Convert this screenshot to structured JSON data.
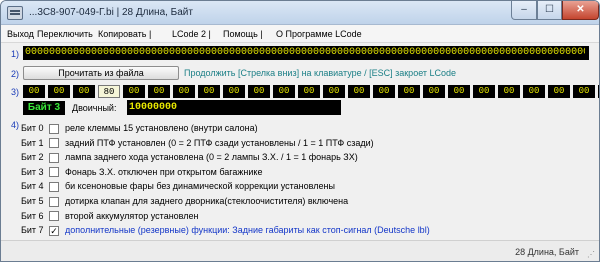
{
  "window": {
    "title": "...3C8-907-049-Г.bi | 28 Длина, Байт",
    "minimize": "–",
    "maximize": "☐",
    "close": "✕"
  },
  "menu": [
    "Выход",
    "Переключить",
    "Копировать |",
    "LCode 2 |",
    "Помощь |",
    "О Программе LCode"
  ],
  "row_numbers": [
    "1)",
    "2)",
    "3)",
    "4)"
  ],
  "coding_string": "00000000000000000000000000000000000000000000000000000000000000000000000000000000000000000000000000000000000",
  "read_button": "Прочитать из файла",
  "hint": "Продолжить [Стрелка вниз] на клавиатуре / [ESC] закроет LCode",
  "hex_bytes": [
    "00",
    "00",
    "00",
    "80",
    "00",
    "00",
    "00",
    "00",
    "00",
    "00",
    "00",
    "00",
    "00",
    "00",
    "00",
    "00",
    "00",
    "00",
    "00",
    "00",
    "00",
    "00",
    "00",
    "00",
    "00",
    "00",
    "00",
    "00"
  ],
  "selected_byte_index": 3,
  "byte_label": "Байт 3",
  "binary_label": "Двоичный:",
  "binary_value": "10000000",
  "bits": [
    {
      "label": "Бит 0",
      "checked": false,
      "text": "реле клеммы 15 установлено (внутри салона)",
      "highlight": false
    },
    {
      "label": "Бит 1",
      "checked": false,
      "text": "задний ПТФ установлен (0 = 2 ПТФ сзади установлены / 1 = 1 ПТФ сзади)",
      "highlight": false
    },
    {
      "label": "Бит 2",
      "checked": false,
      "text": "лампа заднего хода установлена (0 = 2 лампы З.Х. / 1 = 1 фонарь ЗХ)",
      "highlight": false
    },
    {
      "label": "Бит 3",
      "checked": false,
      "text": "Фонарь З.Х. отключен при открытом багажнике",
      "highlight": false
    },
    {
      "label": "Бит 4",
      "checked": false,
      "text": "би ксеноновые фары без динамической коррекции установлены",
      "highlight": false
    },
    {
      "label": "Бит 5",
      "checked": false,
      "text": "дотирка клапан для заднего дворника(стеклоочистителя) включена",
      "highlight": false
    },
    {
      "label": "Бит 6",
      "checked": false,
      "text": "второй аккумулятор установлен",
      "highlight": false
    },
    {
      "label": "Бит 7",
      "checked": true,
      "text": "дополнительные (резервные) функции: Задние габариты как стоп-сигнал (Deutsche lbl)",
      "highlight": true
    }
  ],
  "status": "28 Длина, Байт",
  "check_glyph": "✓",
  "colors": {
    "black_bar": "#000000",
    "yellow_text": "#e8e800",
    "green_text": "#39e639",
    "blue_text": "#1336c8",
    "teal_text": "#1b7f86"
  }
}
